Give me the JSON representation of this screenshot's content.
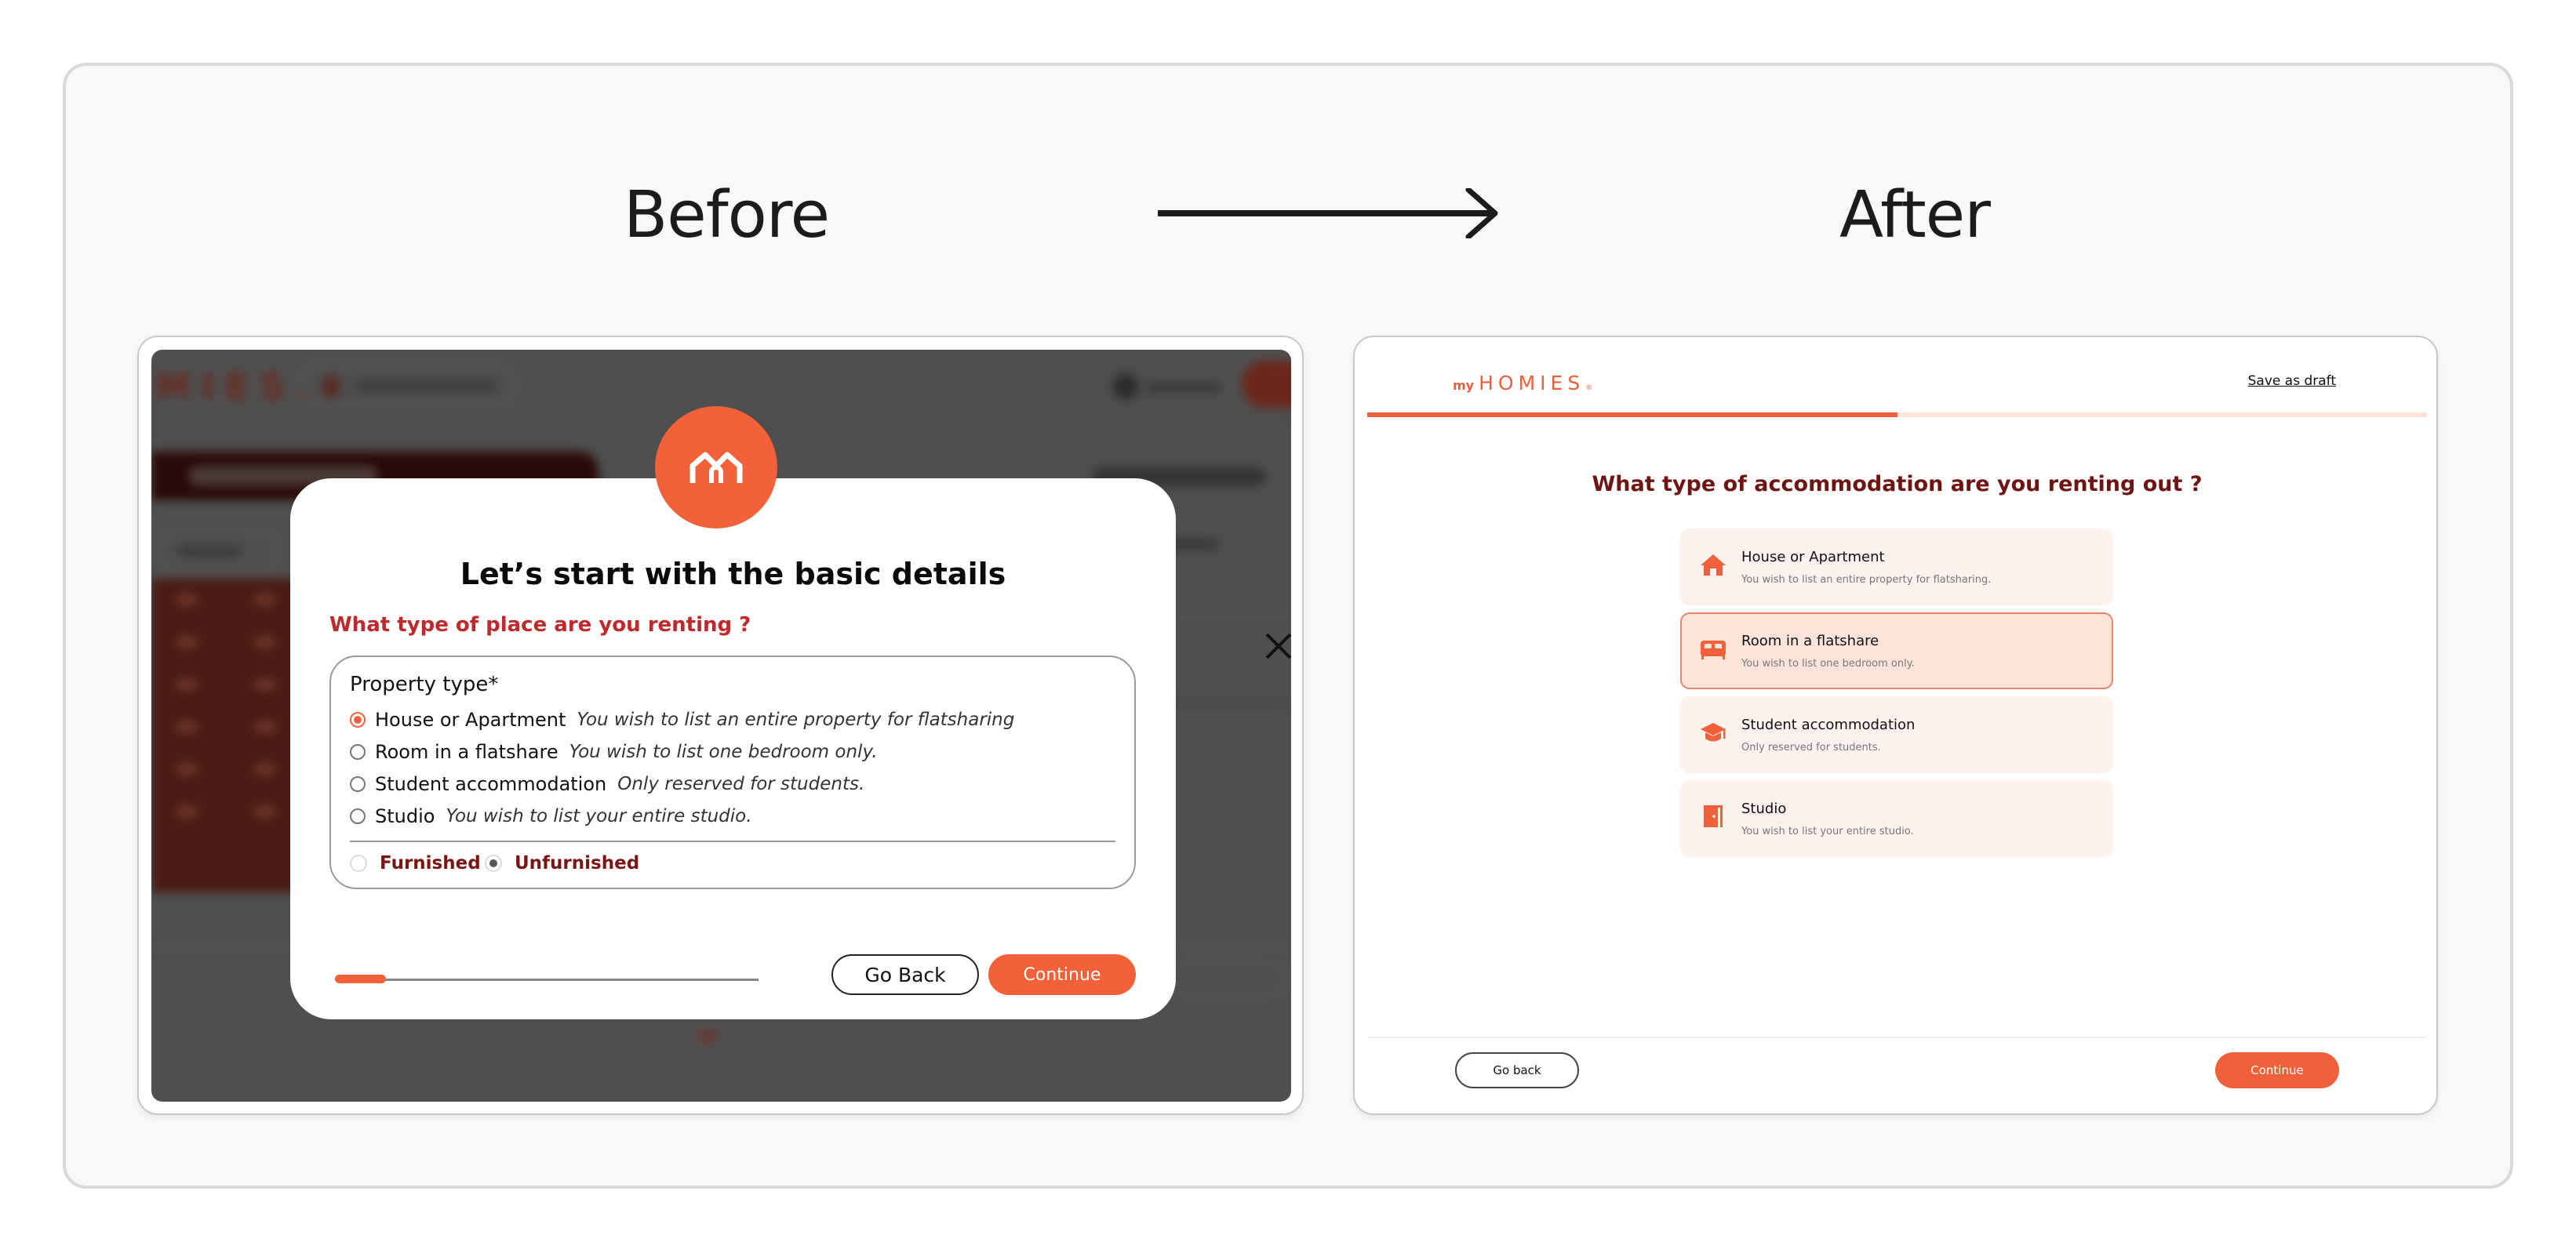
{
  "comparison": {
    "before_label": "Before",
    "after_label": "After"
  },
  "before": {
    "modal": {
      "title": "Let’s start with the basic details",
      "question": "What type of place are you renting ?",
      "property_type_label": "Property type*",
      "options": [
        {
          "label": "House or Apartment",
          "description": "You wish to list an entire property for flatsharing",
          "selected": true
        },
        {
          "label": "Room in a flatshare",
          "description": "You wish to list one bedroom only.",
          "selected": false
        },
        {
          "label": "Student accommodation",
          "description": "Only reserved for students.",
          "selected": false
        },
        {
          "label": "Studio",
          "description": "You wish to list your entire studio.",
          "selected": false
        }
      ],
      "furnishing": [
        {
          "label": "Furnished",
          "selected": false
        },
        {
          "label": "Unfurnished",
          "selected": true
        }
      ],
      "progress_fraction": 0.12,
      "back_label": "Go Back",
      "continue_label": "Continue"
    }
  },
  "after": {
    "logo": {
      "prefix": "my",
      "name": "HOMIES",
      "registered": "®"
    },
    "save_draft_label": "Save as draft",
    "progress_fraction": 0.5,
    "question": "What type of accommodation are you renting out ?",
    "options": [
      {
        "icon": "house-icon",
        "title": "House or Apartment",
        "description": "You wish to list an entire property for flatsharing.",
        "selected": false
      },
      {
        "icon": "bed-icon",
        "title": "Room in a flatshare",
        "description": "You wish to list one bedroom only.",
        "selected": true
      },
      {
        "icon": "graduation-cap-icon",
        "title": "Student accommodation",
        "description": "Only reserved for students.",
        "selected": false
      },
      {
        "icon": "door-icon",
        "title": "Studio",
        "description": "You wish to list your entire studio.",
        "selected": false
      }
    ],
    "back_label": "Go back",
    "continue_label": "Continue"
  },
  "colors": {
    "brand_orange": "#f2613a",
    "question_red": "#c0282b",
    "dark_maroon": "#6e1412",
    "option_bg": "#fdf2ee",
    "option_selected_bg": "#fde4da"
  }
}
